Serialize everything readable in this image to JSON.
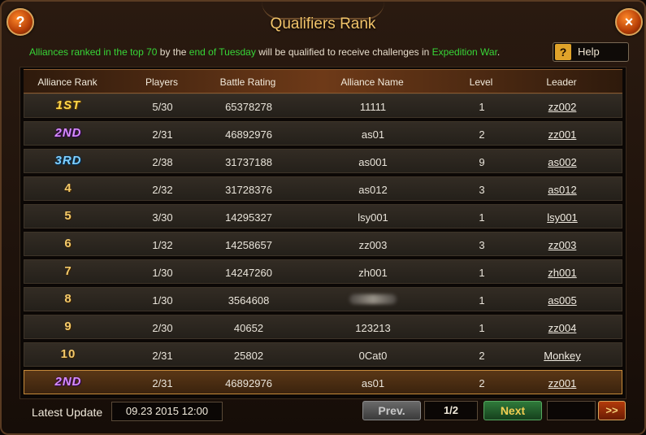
{
  "window": {
    "title": "Qualifiers Rank",
    "help_icon": "?",
    "close_icon": "×"
  },
  "info": {
    "p1": "Alliances ranked in the top 70",
    "p2": " by the ",
    "p3": "end of Tuesday",
    "p4": " will be qualified to receive challenges in ",
    "p5": "Expedition War",
    "p6": "."
  },
  "help": {
    "icon": "?",
    "label": "Help"
  },
  "columns": [
    "Alliance Rank",
    "Players",
    "Battle Rating",
    "Alliance Name",
    "Level",
    "Leader"
  ],
  "rows": [
    {
      "rank": "1ST",
      "players": "5/30",
      "rating": "65378278",
      "name": "11111",
      "level": "1",
      "leader": "zz002"
    },
    {
      "rank": "2ND",
      "players": "2/31",
      "rating": "46892976",
      "name": "as01",
      "level": "2",
      "leader": "zz001"
    },
    {
      "rank": "3RD",
      "players": "2/38",
      "rating": "31737188",
      "name": "as001",
      "level": "9",
      "leader": "as002"
    },
    {
      "rank": "4",
      "players": "2/32",
      "rating": "31728376",
      "name": "as012",
      "level": "3",
      "leader": "as012"
    },
    {
      "rank": "5",
      "players": "3/30",
      "rating": "14295327",
      "name": "lsy001",
      "level": "1",
      "leader": "lsy001"
    },
    {
      "rank": "6",
      "players": "1/32",
      "rating": "14258657",
      "name": "zz003",
      "level": "3",
      "leader": "zz003"
    },
    {
      "rank": "7",
      "players": "1/30",
      "rating": "14247260",
      "name": "zh001",
      "level": "1",
      "leader": "zh001"
    },
    {
      "rank": "8",
      "players": "1/30",
      "rating": "3564608",
      "name": "",
      "level": "1",
      "leader": "as005"
    },
    {
      "rank": "9",
      "players": "2/30",
      "rating": "40652",
      "name": "123213",
      "level": "1",
      "leader": "zz004"
    },
    {
      "rank": "10",
      "players": "2/31",
      "rating": "25802",
      "name": "0Cat0",
      "level": "2",
      "leader": "Monkey"
    }
  ],
  "my_row": {
    "rank": "2ND",
    "players": "2/31",
    "rating": "46892976",
    "name": "as01",
    "level": "2",
    "leader": "zz001"
  },
  "footer": {
    "latest_update_label": "Latest Update",
    "timestamp": "09.23 2015 12:00",
    "prev": "Prev.",
    "page": "1/2",
    "next": "Next",
    "last": ">>"
  },
  "colors": {
    "green_text": "#37d537",
    "title": "#f2c46a",
    "rank1": "#ffd84a",
    "rank2": "#d78cff",
    "rank3": "#7fd0ff"
  }
}
